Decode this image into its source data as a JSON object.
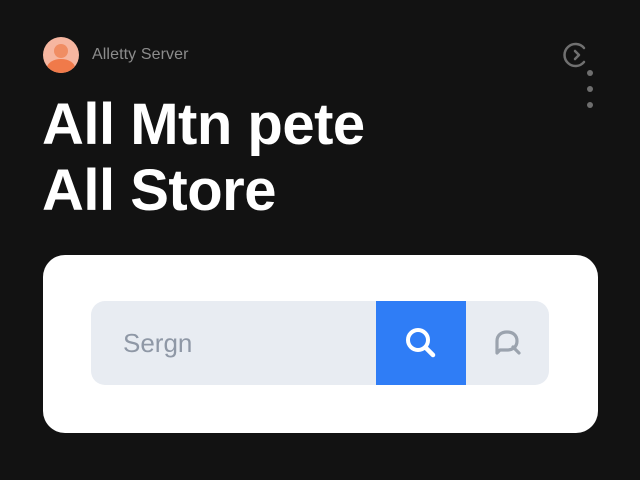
{
  "header": {
    "server_label": "Alletty Server",
    "avatar_icon": "user-avatar-icon"
  },
  "headline": {
    "line1": "All Mtn pete",
    "line2": "All Store"
  },
  "controls": {
    "arrow_icon": "arrow-right-circle-icon",
    "menu_icon": "vertical-dots-icon"
  },
  "search": {
    "placeholder": "Sergn",
    "value": "",
    "button_icon": "search-icon",
    "secondary_icon": "search-chat-icon"
  },
  "colors": {
    "background": "#121212",
    "accent": "#2F7DF6",
    "card": "#FFFFFF",
    "search_field": "#E8ECF2"
  }
}
